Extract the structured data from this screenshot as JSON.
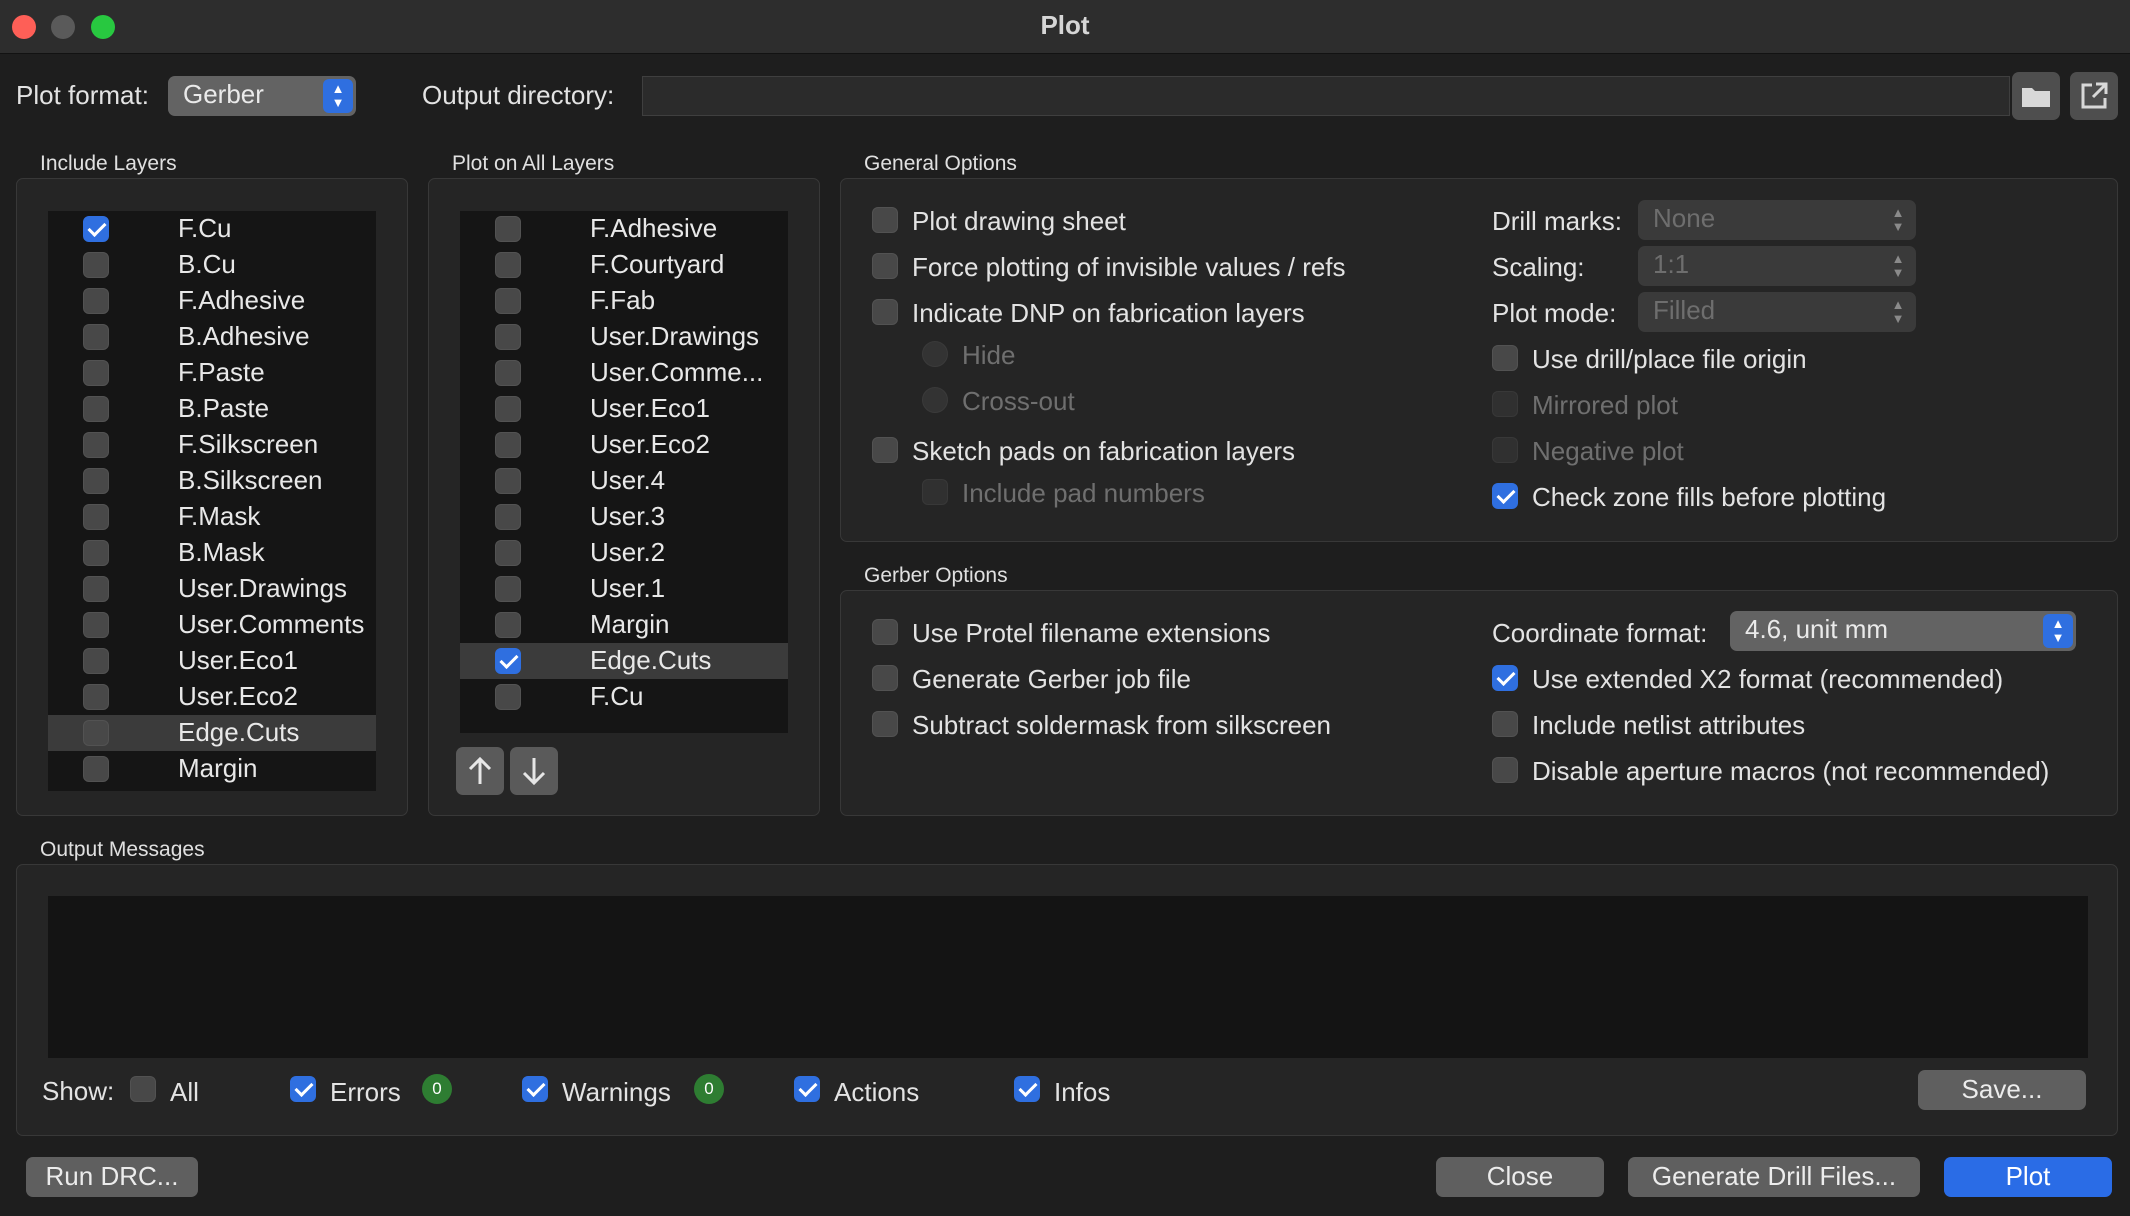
{
  "window": {
    "title": "Plot"
  },
  "top": {
    "plot_format_label": "Plot format:",
    "plot_format_value": "Gerber",
    "output_dir_label": "Output directory:",
    "output_dir_value": ""
  },
  "include_layers": {
    "title": "Include Layers",
    "items": [
      {
        "label": "F.Cu",
        "checked": true
      },
      {
        "label": "B.Cu",
        "checked": false
      },
      {
        "label": "F.Adhesive",
        "checked": false
      },
      {
        "label": "B.Adhesive",
        "checked": false
      },
      {
        "label": "F.Paste",
        "checked": false
      },
      {
        "label": "B.Paste",
        "checked": false
      },
      {
        "label": "F.Silkscreen",
        "checked": false
      },
      {
        "label": "B.Silkscreen",
        "checked": false
      },
      {
        "label": "F.Mask",
        "checked": false
      },
      {
        "label": "B.Mask",
        "checked": false
      },
      {
        "label": "User.Drawings",
        "checked": false
      },
      {
        "label": "User.Comments",
        "checked": false
      },
      {
        "label": "User.Eco1",
        "checked": false
      },
      {
        "label": "User.Eco2",
        "checked": false
      },
      {
        "label": "Edge.Cuts",
        "checked": false,
        "selected": true
      },
      {
        "label": "Margin",
        "checked": false
      }
    ]
  },
  "plot_all_layers": {
    "title": "Plot on All Layers",
    "items": [
      {
        "label": "F.Adhesive",
        "checked": false
      },
      {
        "label": "F.Courtyard",
        "checked": false
      },
      {
        "label": "F.Fab",
        "checked": false
      },
      {
        "label": "User.Drawings",
        "checked": false
      },
      {
        "label": "User.Comme...",
        "checked": false
      },
      {
        "label": "User.Eco1",
        "checked": false
      },
      {
        "label": "User.Eco2",
        "checked": false
      },
      {
        "label": "User.4",
        "checked": false
      },
      {
        "label": "User.3",
        "checked": false
      },
      {
        "label": "User.2",
        "checked": false
      },
      {
        "label": "User.1",
        "checked": false
      },
      {
        "label": "Margin",
        "checked": false
      },
      {
        "label": "Edge.Cuts",
        "checked": true,
        "selected": true
      },
      {
        "label": "F.Cu",
        "checked": false
      }
    ]
  },
  "general_options": {
    "title": "General Options",
    "plot_drawing_sheet": "Plot drawing sheet",
    "force_invisible": "Force plotting of invisible values / refs",
    "indicate_dnp": "Indicate DNP on fabrication layers",
    "hide": "Hide",
    "cross_out": "Cross-out",
    "sketch_pads": "Sketch pads on fabrication layers",
    "include_pad_numbers": "Include pad numbers",
    "drill_marks_label": "Drill marks:",
    "drill_marks_value": "None",
    "scaling_label": "Scaling:",
    "scaling_value": "1:1",
    "plot_mode_label": "Plot mode:",
    "plot_mode_value": "Filled",
    "use_drill_origin": "Use drill/place file origin",
    "mirrored_plot": "Mirrored plot",
    "negative_plot": "Negative plot",
    "check_zone_fills": "Check zone fills before plotting"
  },
  "gerber_options": {
    "title": "Gerber Options",
    "protel_ext": "Use Protel filename extensions",
    "job_file": "Generate Gerber job file",
    "subtract_mask": "Subtract soldermask from silkscreen",
    "coord_format_label": "Coordinate format:",
    "coord_format_value": "4.6, unit mm",
    "x2_format": "Use extended X2 format (recommended)",
    "netlist_attrs": "Include netlist attributes",
    "disable_macros": "Disable aperture macros (not recommended)"
  },
  "output_messages": {
    "title": "Output Messages",
    "show_label": "Show:",
    "all": "All",
    "errors": "Errors",
    "errors_count": "0",
    "warnings": "Warnings",
    "warnings_count": "0",
    "actions": "Actions",
    "infos": "Infos",
    "save": "Save..."
  },
  "footer": {
    "run_drc": "Run DRC...",
    "close": "Close",
    "generate_drill": "Generate Drill Files...",
    "plot": "Plot"
  },
  "colors": {
    "accent": "#2f6fe0",
    "badge": "#2e7d32"
  }
}
